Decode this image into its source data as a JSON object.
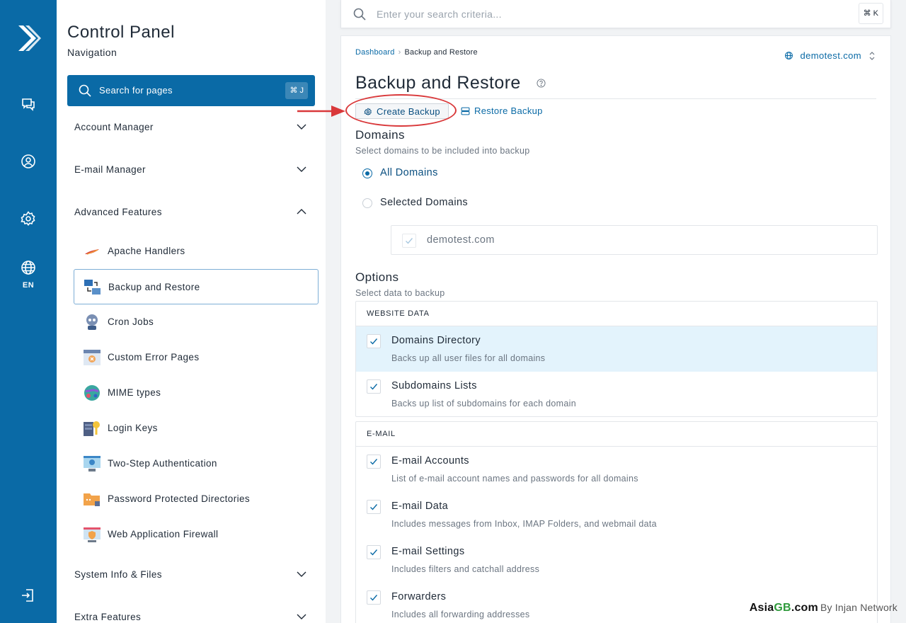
{
  "rail": {
    "icons": [
      "logo-icon",
      "chat-icon",
      "user-circle-icon",
      "gear-icon",
      "globe-icon",
      "logout-icon"
    ],
    "language": "EN"
  },
  "nav": {
    "title": "Control Panel",
    "subtitle": "Navigation",
    "search": {
      "placeholder": "Search for pages",
      "shortcut": "⌘ J"
    },
    "sections": [
      {
        "label": "Account Manager",
        "expanded": false
      },
      {
        "label": "E-mail Manager",
        "expanded": false
      },
      {
        "label": "Advanced Features",
        "expanded": true
      },
      {
        "label": "System Info & Files",
        "expanded": false
      },
      {
        "label": "Extra Features",
        "expanded": false
      }
    ],
    "advanced_items": [
      {
        "label": "Apache Handlers",
        "icon": "feather-icon"
      },
      {
        "label": "Backup and Restore",
        "icon": "backup-icon",
        "active": true
      },
      {
        "label": "Cron Jobs",
        "icon": "robot-icon"
      },
      {
        "label": "Custom Error Pages",
        "icon": "error-page-icon"
      },
      {
        "label": "MIME types",
        "icon": "mime-globe-icon"
      },
      {
        "label": "Login Keys",
        "icon": "key-icon"
      },
      {
        "label": "Two-Step Authentication",
        "icon": "two-step-icon"
      },
      {
        "label": "Password Protected Directories",
        "icon": "locked-folder-icon"
      },
      {
        "label": "Web Application Firewall",
        "icon": "firewall-icon"
      }
    ]
  },
  "topbar": {
    "placeholder": "Enter your search criteria...",
    "shortcut": "⌘ K"
  },
  "breadcrumb": {
    "home": "Dashboard",
    "current": "Backup and Restore"
  },
  "domain_selector": "demotest.com",
  "page": {
    "title": "Backup and Restore",
    "tabs": {
      "create": "Create Backup",
      "restore": "Restore Backup"
    }
  },
  "domains": {
    "heading": "Domains",
    "subheading": "Select domains to be included into backup",
    "all": "All Domains",
    "selected": "Selected Domains",
    "selected_mode": "all",
    "list": [
      "demotest.com"
    ]
  },
  "options": {
    "heading": "Options",
    "subheading": "Select data to backup",
    "website_group": {
      "title": "WEBSITE DATA",
      "items": [
        {
          "title": "Domains Directory",
          "desc": "Backs up all user files for all domains",
          "checked": true,
          "highlighted": true
        },
        {
          "title": "Subdomains Lists",
          "desc": "Backs up list of subdomains for each domain",
          "checked": true
        }
      ]
    },
    "email_group": {
      "title": "E-MAIL",
      "items": [
        {
          "title": "E-mail Accounts",
          "desc": "List of e-mail account names and passwords for all domains",
          "checked": true
        },
        {
          "title": "E-mail Data",
          "desc": "Includes messages from Inbox, IMAP Folders, and webmail data",
          "checked": true
        },
        {
          "title": "E-mail Settings",
          "desc": "Includes filters and catchall address",
          "checked": true
        },
        {
          "title": "Forwarders",
          "desc": "Includes all forwarding addresses",
          "checked": true
        }
      ]
    }
  },
  "watermark": {
    "brand_a": "Asia",
    "brand_b": "GB",
    "brand_c": ".com",
    "byline": "By Injan Network"
  },
  "colors": {
    "primary": "#0a6aa6",
    "annotation": "#d9383a",
    "highlight_row": "#e3f3fc"
  }
}
